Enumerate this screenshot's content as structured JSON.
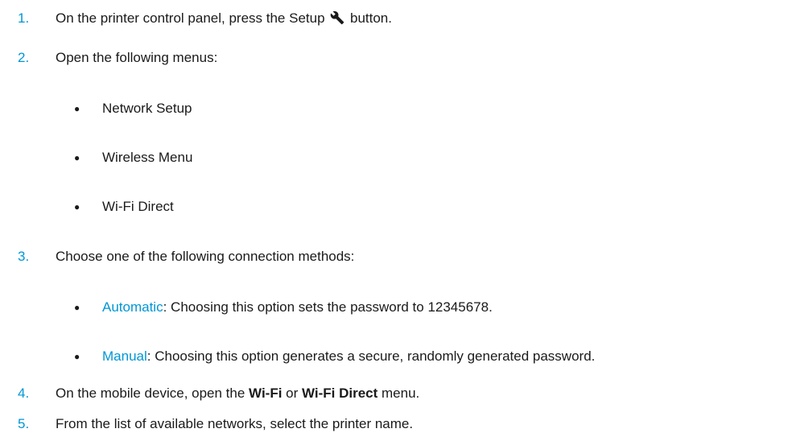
{
  "steps": [
    {
      "number": "1.",
      "before_icon": "On the printer control panel, press the Setup ",
      "icon": "wrench-icon",
      "after_icon": " button."
    },
    {
      "number": "2.",
      "text": "Open the following menus:",
      "bullets": [
        "Network Setup",
        "Wireless Menu",
        "Wi-Fi Direct"
      ]
    },
    {
      "number": "3.",
      "text": "Choose one of the following connection methods:",
      "bullets": [
        {
          "term": "Automatic",
          "rest": ": Choosing this option sets the password to 12345678."
        },
        {
          "term": "Manual",
          "rest": ": Choosing this option generates a secure, randomly generated password."
        }
      ]
    },
    {
      "number": "4.",
      "part1": "On the mobile device, open the ",
      "bold1": "Wi-Fi",
      "part2": " or ",
      "bold2": "Wi-Fi Direct",
      "part3": " menu."
    },
    {
      "number": "5.",
      "text": "From the list of available networks, select the printer name."
    }
  ],
  "bullet_glyph": "●",
  "colors": {
    "accent": "#0096d6",
    "text": "#1a1a1a"
  }
}
